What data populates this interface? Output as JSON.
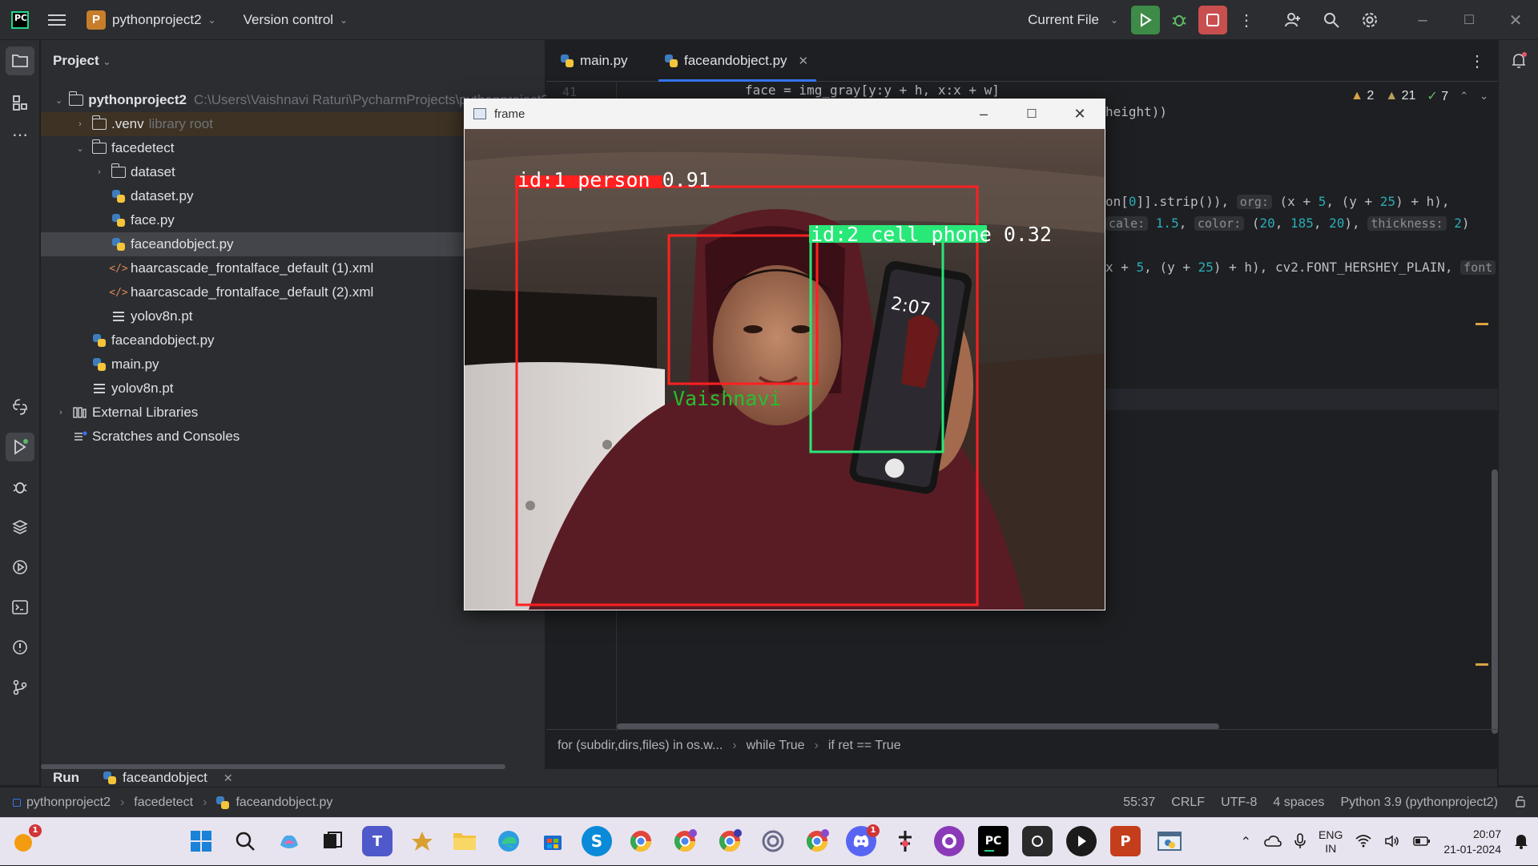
{
  "topbar": {
    "project_badge": "P",
    "project_name": "pythonproject2",
    "vcs": "Version control",
    "run_config": "Current File"
  },
  "project_panel": {
    "title": "Project",
    "tree": [
      {
        "label": "pythonproject2",
        "path": "C:\\Users\\Vaishnavi Raturi\\PycharmProjects\\pythonproject2",
        "type": "root"
      },
      {
        "label": ".venv",
        "path": "library root",
        "type": "folder"
      },
      {
        "label": "facedetect",
        "type": "folder"
      },
      {
        "label": "dataset",
        "type": "folder"
      },
      {
        "label": "dataset.py",
        "type": "py"
      },
      {
        "label": "face.py",
        "type": "py"
      },
      {
        "label": "faceandobject.py",
        "type": "py"
      },
      {
        "label": "haarcascade_frontalface_default (1).xml",
        "type": "xml"
      },
      {
        "label": "haarcascade_frontalface_default (2).xml",
        "type": "xml"
      },
      {
        "label": "yolov8n.pt",
        "type": "txt"
      },
      {
        "label": "faceandobject.py",
        "type": "py"
      },
      {
        "label": "main.py",
        "type": "py"
      },
      {
        "label": "yolov8n.pt",
        "type": "txt"
      },
      {
        "label": "External Libraries",
        "type": "lib"
      },
      {
        "label": "Scratches and Consoles",
        "type": "scratch"
      }
    ]
  },
  "editor": {
    "tabs": [
      {
        "label": "main.py"
      },
      {
        "label": "faceandobject.py",
        "active": true
      }
    ],
    "line_number": "41",
    "code": {
      "line1": "face = img_gray[y:y + h, x:x + w]",
      "line2": "height))",
      "line3_a": "on[",
      "line3_b": "0",
      "line3_c": "]].strip()),",
      "line3_hint": "org:",
      "line3_d": "(x + ",
      "line3_e": "5",
      "line3_f": ", (y + ",
      "line3_g": "25",
      "line3_h": ") + h),",
      "line4_a": "cale:",
      "line4_b": "1.5",
      "line4_c": ",",
      "line4_hint1": "color:",
      "line4_d": "(",
      "line4_e": "20",
      "line4_f": ", ",
      "line4_g": "185",
      "line4_h": ", ",
      "line4_i": "20",
      "line4_j": "),",
      "line4_hint2": "thickness:",
      "line4_k": "2",
      "line4_l": ")",
      "line5_a": "x + ",
      "line5_b": "5",
      "line5_c": ", (y + ",
      "line5_d": "25",
      "line5_e": ") + h), cv2.FONT_HERSHEY_PLAIN,",
      "line5_hint": "font"
    },
    "inspections": {
      "warn_a": "2",
      "warn_b": "21",
      "ok": "7"
    },
    "breadcrumbs": [
      "for (subdir,dirs,files) in os.w...",
      "while True",
      "if ret == True"
    ]
  },
  "frame_window": {
    "title": "frame",
    "detections": [
      {
        "label": "id:1 person 0.91",
        "color": "#ff2020"
      },
      {
        "label": "id:2 cell phone 0.32",
        "color": "#28e878"
      }
    ],
    "face_label": "Vaishnavi",
    "phone_screen_time": "2:07"
  },
  "runbar": {
    "title": "Run",
    "tab": "faceandobject"
  },
  "statusbar": {
    "crumbs": [
      "pythonproject2",
      "facedetect",
      "faceandobject.py"
    ],
    "position": "55:37",
    "line_sep": "CRLF",
    "encoding": "UTF-8",
    "indent": "4 spaces",
    "interpreter": "Python 3.9 (pythonproject2)"
  },
  "taskbar": {
    "weather_badge": "1",
    "discord_badge": "1",
    "lang_top": "ENG",
    "lang_bottom": "IN",
    "time": "20:07",
    "date": "21-01-2024"
  }
}
